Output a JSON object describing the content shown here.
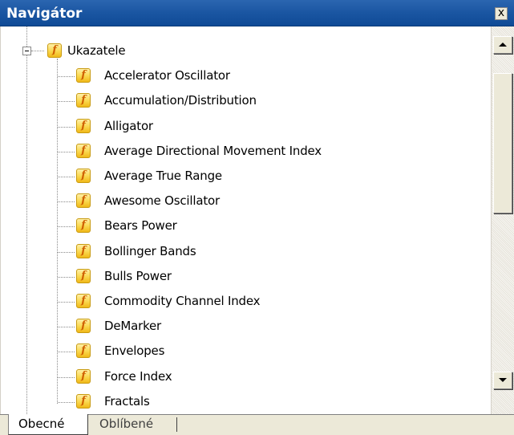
{
  "window": {
    "title": "Navigátor",
    "close_label": "x"
  },
  "tree": {
    "root": {
      "label": "Ukazatele",
      "icon": "function-icon",
      "expanded": true
    },
    "items": [
      {
        "label": "Accelerator Oscillator",
        "icon": "function-icon"
      },
      {
        "label": "Accumulation/Distribution",
        "icon": "function-icon"
      },
      {
        "label": "Alligator",
        "icon": "function-icon"
      },
      {
        "label": "Average Directional Movement Index",
        "icon": "function-icon"
      },
      {
        "label": "Average True Range",
        "icon": "function-icon"
      },
      {
        "label": "Awesome Oscillator",
        "icon": "function-icon"
      },
      {
        "label": "Bears Power",
        "icon": "function-icon"
      },
      {
        "label": "Bollinger Bands",
        "icon": "function-icon"
      },
      {
        "label": "Bulls Power",
        "icon": "function-icon"
      },
      {
        "label": "Commodity Channel Index",
        "icon": "function-icon"
      },
      {
        "label": "DeMarker",
        "icon": "function-icon"
      },
      {
        "label": "Envelopes",
        "icon": "function-icon"
      },
      {
        "label": "Force Index",
        "icon": "function-icon"
      },
      {
        "label": "Fractals",
        "icon": "function-icon"
      }
    ]
  },
  "icon_glyph": "f",
  "tabs": [
    {
      "label": "Obecné",
      "active": true
    },
    {
      "label": "Oblíbené",
      "active": false
    }
  ],
  "colors": {
    "title_bar": "#1a56a2",
    "icon_fill": "#fad84e",
    "icon_glyph": "#d06000"
  }
}
